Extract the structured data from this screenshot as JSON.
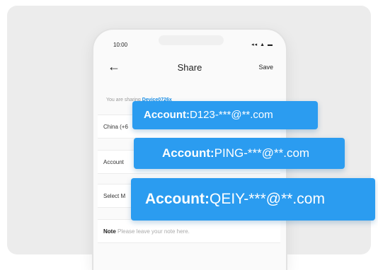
{
  "status": {
    "time": "10:00",
    "icons": "◂◂ ▲ ▬"
  },
  "header": {
    "title": "Share",
    "save_label": "Save",
    "back_icon": "←"
  },
  "info": {
    "text": "You are sharing ",
    "device": "Device0726x"
  },
  "fields": {
    "region": "China (+6",
    "account": "Account",
    "select": "Select M",
    "note_label": "Note",
    "note_placeholder": "Please leave your note here."
  },
  "chips": [
    {
      "label": "Account:",
      "value": "D123-***@**.com"
    },
    {
      "label": "Account:",
      "value": "PING-***@**.com"
    },
    {
      "label": "Account:",
      "value": "QEIY-***@**.com"
    }
  ],
  "colors": {
    "accent": "#2b9cf0"
  }
}
